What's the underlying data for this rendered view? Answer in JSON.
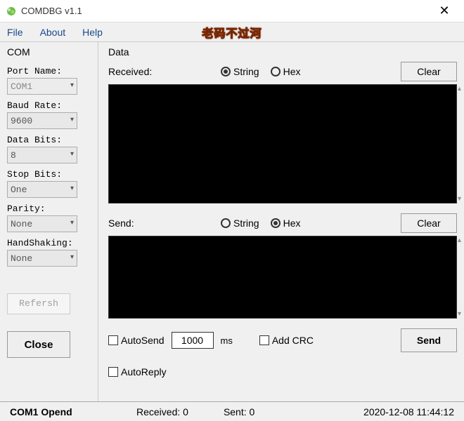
{
  "window": {
    "title": "COMDBG v1.1",
    "close_glyph": "✕"
  },
  "menubar": {
    "items": [
      "File",
      "About",
      "Help"
    ],
    "watermark": "老码不过河"
  },
  "sidebar": {
    "group_label": "COM",
    "port_name": {
      "label": "Port Name:",
      "value": "COM1"
    },
    "baud_rate": {
      "label": "Baud Rate:",
      "value": "9600"
    },
    "data_bits": {
      "label": "Data Bits:",
      "value": "8"
    },
    "stop_bits": {
      "label": "Stop Bits:",
      "value": "One"
    },
    "parity": {
      "label": "Parity:",
      "value": "None"
    },
    "handshake": {
      "label": "HandShaking:",
      "value": "None"
    },
    "refresh_label": "Refersh",
    "close_label": "Close"
  },
  "data_panel": {
    "group_label": "Data",
    "received_label": "Received:",
    "send_label": "Send:",
    "radio_string": "String",
    "radio_hex": "Hex",
    "clear_label": "Clear",
    "rx_mode": "String",
    "tx_mode": "Hex",
    "autosend_label": "AutoSend",
    "autosend_interval": "1000",
    "autosend_unit": "ms",
    "addcrc_label": "Add CRC",
    "autoreply_label": "AutoReply",
    "send_button": "Send"
  },
  "statusbar": {
    "port_status": "COM1 Opend",
    "received_label": "Received: 0",
    "sent_label": "Sent: 0",
    "timestamp": "2020-12-08 11:44:12"
  }
}
